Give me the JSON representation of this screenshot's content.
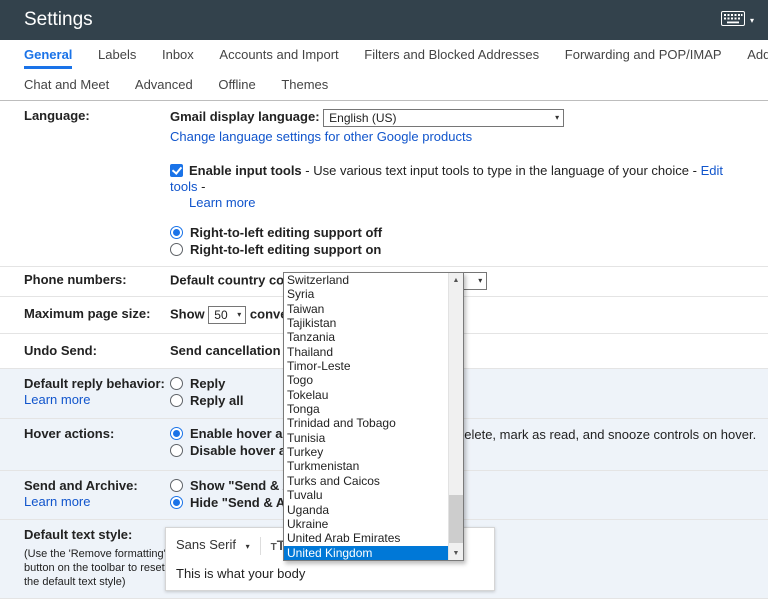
{
  "colors": {
    "accent": "#1a73e8",
    "link_blue": "#1155cc",
    "dropdown_selection": "#0078d7"
  },
  "icons": {
    "caret_down": "▾",
    "scroll_up_arrow": "▲",
    "scroll_down_arrow": "▼"
  },
  "header": {
    "title": "Settings"
  },
  "tabs": {
    "row1": [
      {
        "label": "General"
      },
      {
        "label": "Labels"
      },
      {
        "label": "Inbox"
      },
      {
        "label": "Accounts and Import"
      },
      {
        "label": "Filters and Blocked Addresses"
      },
      {
        "label": "Forwarding and POP/IMAP"
      },
      {
        "label": "Add-ons"
      }
    ],
    "row2": [
      {
        "label": "Chat and Meet"
      },
      {
        "label": "Advanced"
      },
      {
        "label": "Offline"
      },
      {
        "label": "Themes"
      }
    ]
  },
  "language": {
    "row_label": "Language:",
    "display_label": "Gmail display language:",
    "display_value": "English (US)",
    "change_link": "Change language settings for other Google products",
    "input_tools_bold": "Enable input tools",
    "input_tools_text": " - Use various text input tools to type in the language of your choice - ",
    "edit_tools_link": "Edit tools",
    "after_edit_tools": " -",
    "learn_more_link": "Learn more",
    "rtl_off": "Right-to-left editing support off",
    "rtl_on": "Right-to-left editing support on"
  },
  "phone": {
    "row_label": "Phone numbers:",
    "code_label": "Default country code:",
    "code_value": "United Kingdom"
  },
  "country_dropdown": {
    "selected_option": "United Kingdom",
    "options": [
      "Switzerland",
      "Syria",
      "Taiwan",
      "Tajikistan",
      "Tanzania",
      "Thailand",
      "Timor-Leste",
      "Togo",
      "Tokelau",
      "Tonga",
      "Trinidad and Tobago",
      "Tunisia",
      "Turkey",
      "Turkmenistan",
      "Turks and Caicos",
      "Tuvalu",
      "Uganda",
      "Ukraine",
      "United Arab Emirates",
      "United Kingdom"
    ]
  },
  "page_size": {
    "row_label": "Maximum page size:",
    "show_label": "Show",
    "value": "50",
    "trailing_text": "conver"
  },
  "undo_send": {
    "row_label": "Undo Send:",
    "text": "Send cancellation peri"
  },
  "reply": {
    "row_label": "Default reply behavior:",
    "learn_more_link": "Learn more",
    "option_reply": "Reply",
    "option_reply_all": "Reply all"
  },
  "hover": {
    "row_label": "Hover actions:",
    "enable_option": "Enable hover action",
    "disable_option": "Disable hover actio",
    "visible_tail": "delete, mark as read, and snooze controls on hover."
  },
  "send_archive": {
    "row_label": "Send and Archive:",
    "learn_more_link": "Learn more",
    "show_option": "Show \"Send & Arch",
    "hide_option": "Hide \"Send & Archi"
  },
  "text_style": {
    "row_label": "Default text style:",
    "note": "(Use the 'Remove formatting' button on the toolbar to reset the default text style)",
    "font_name": "Sans Serif",
    "preview_text": "This is what your body"
  }
}
